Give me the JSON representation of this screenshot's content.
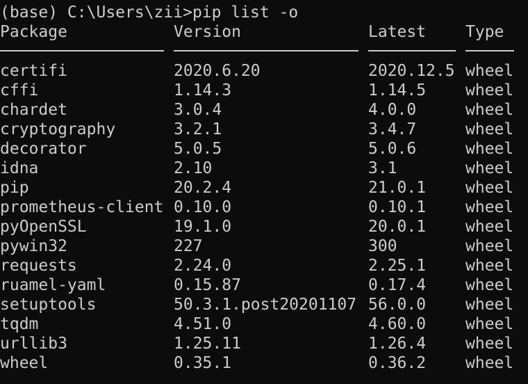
{
  "colors": {
    "background": "#0c0c0c",
    "foreground": "#cccccc"
  },
  "prompt": "(base) C:\\Users\\zii>pip list -o",
  "headers": {
    "package": "Package",
    "version": "Version",
    "latest": "Latest",
    "type": "Type"
  },
  "rows": [
    {
      "package": "certifi",
      "version": "2020.6.20",
      "latest": "2020.12.5",
      "type": "wheel"
    },
    {
      "package": "cffi",
      "version": "1.14.3",
      "latest": "1.14.5",
      "type": "wheel"
    },
    {
      "package": "chardet",
      "version": "3.0.4",
      "latest": "4.0.0",
      "type": "wheel"
    },
    {
      "package": "cryptography",
      "version": "3.2.1",
      "latest": "3.4.7",
      "type": "wheel"
    },
    {
      "package": "decorator",
      "version": "5.0.5",
      "latest": "5.0.6",
      "type": "wheel"
    },
    {
      "package": "idna",
      "version": "2.10",
      "latest": "3.1",
      "type": "wheel"
    },
    {
      "package": "pip",
      "version": "20.2.4",
      "latest": "21.0.1",
      "type": "wheel"
    },
    {
      "package": "prometheus-client",
      "version": "0.10.0",
      "latest": "0.10.1",
      "type": "wheel"
    },
    {
      "package": "pyOpenSSL",
      "version": "19.1.0",
      "latest": "20.0.1",
      "type": "wheel"
    },
    {
      "package": "pywin32",
      "version": "227",
      "latest": "300",
      "type": "wheel"
    },
    {
      "package": "requests",
      "version": "2.24.0",
      "latest": "2.25.1",
      "type": "wheel"
    },
    {
      "package": "ruamel-yaml",
      "version": "0.15.87",
      "latest": "0.17.4",
      "type": "wheel"
    },
    {
      "package": "setuptools",
      "version": "50.3.1.post20201107",
      "latest": "56.0.0",
      "type": "wheel"
    },
    {
      "package": "tqdm",
      "version": "4.51.0",
      "latest": "4.60.0",
      "type": "wheel"
    },
    {
      "package": "urllib3",
      "version": "1.25.11",
      "latest": "1.26.4",
      "type": "wheel"
    },
    {
      "package": "wheel",
      "version": "0.35.1",
      "latest": "0.36.2",
      "type": "wheel"
    }
  ]
}
